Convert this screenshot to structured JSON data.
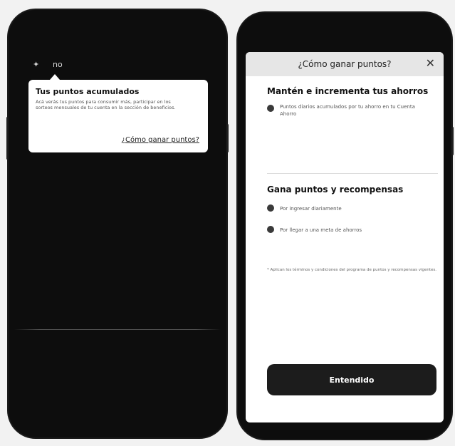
{
  "left_screen": {
    "status_text": "no",
    "tooltip": {
      "title": "Tus puntos acumulados",
      "description": "Acá verás tus puntos para consumir más, participar en los sorteos mensuales de tu cuenta en la sección de beneficios.",
      "link_label": "¿Cómo ganar puntos?"
    }
  },
  "right_screen": {
    "sheet": {
      "title": "¿Cómo ganar puntos?",
      "close_icon": "close-icon",
      "section1": {
        "title": "Mantén e incrementa tus ahorros",
        "items": [
          "Puntos diarios acumulados por tu ahorro en tu Cuenta Ahorro"
        ]
      },
      "section2": {
        "title": "Gana puntos y recompensas",
        "items": [
          "Por ingresar diariamente",
          "Por llegar a una meta de ahorros"
        ]
      },
      "footnote": "* Aplican los términos y condiciones del programa de puntos y recompensas vigentes.",
      "primary_button_label": "Entendido"
    }
  },
  "colors": {
    "phone_body": "#0d0d0d",
    "card_bg": "#ffffff",
    "header_bg": "#e6e6e6",
    "button_bg": "#1c1c1c"
  }
}
